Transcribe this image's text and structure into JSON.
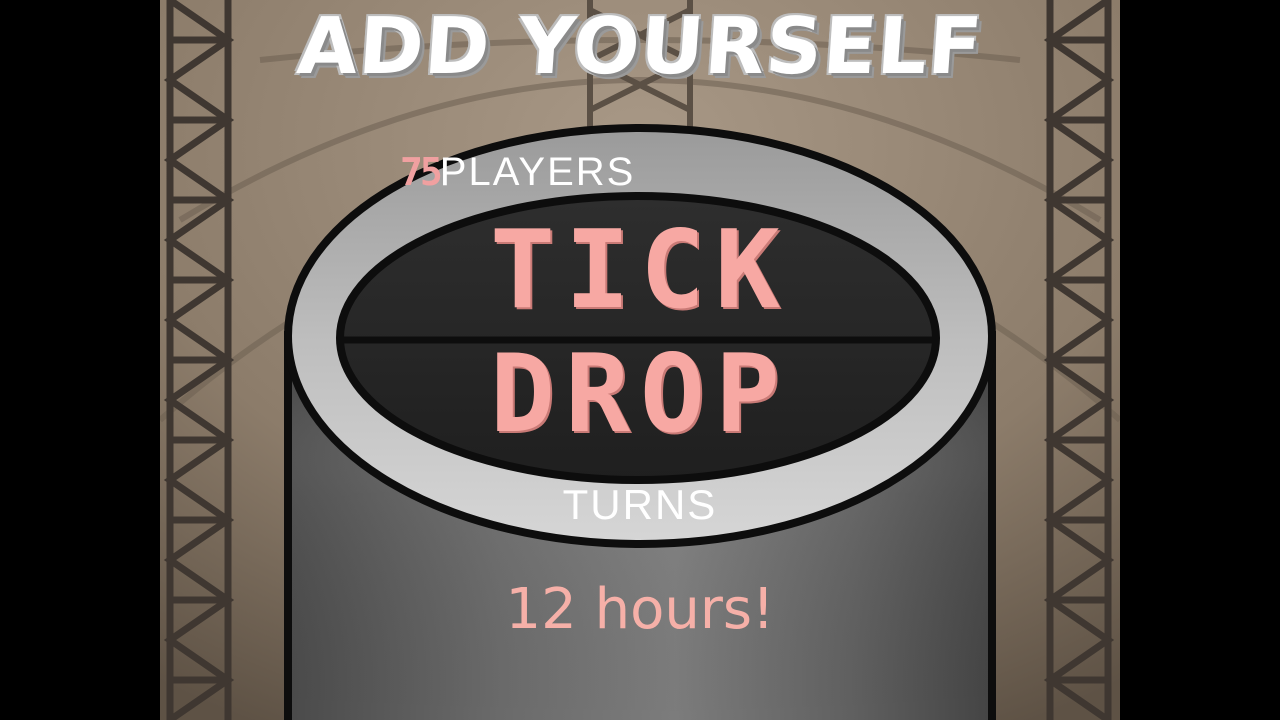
{
  "game": {
    "title": "ADD YOURSELF",
    "players_count": "75",
    "players_label": "PLAYERS",
    "logo_line_1": "TICK",
    "logo_line_2": "DROP",
    "turns_label": "TURNS",
    "duration_text": "12 hours!"
  },
  "colors": {
    "background_brown": "#8f7f6c",
    "cylinder_gray": "#5a5a5a",
    "lcd_pink": "#f7a8a3",
    "lcd_screen": "#262626",
    "outline": "#0d0d0d"
  },
  "icons": {
    "scaffold_left": "scaffold-tower-icon",
    "scaffold_right": "scaffold-tower-icon",
    "scaffold_center": "scaffold-tower-icon"
  }
}
